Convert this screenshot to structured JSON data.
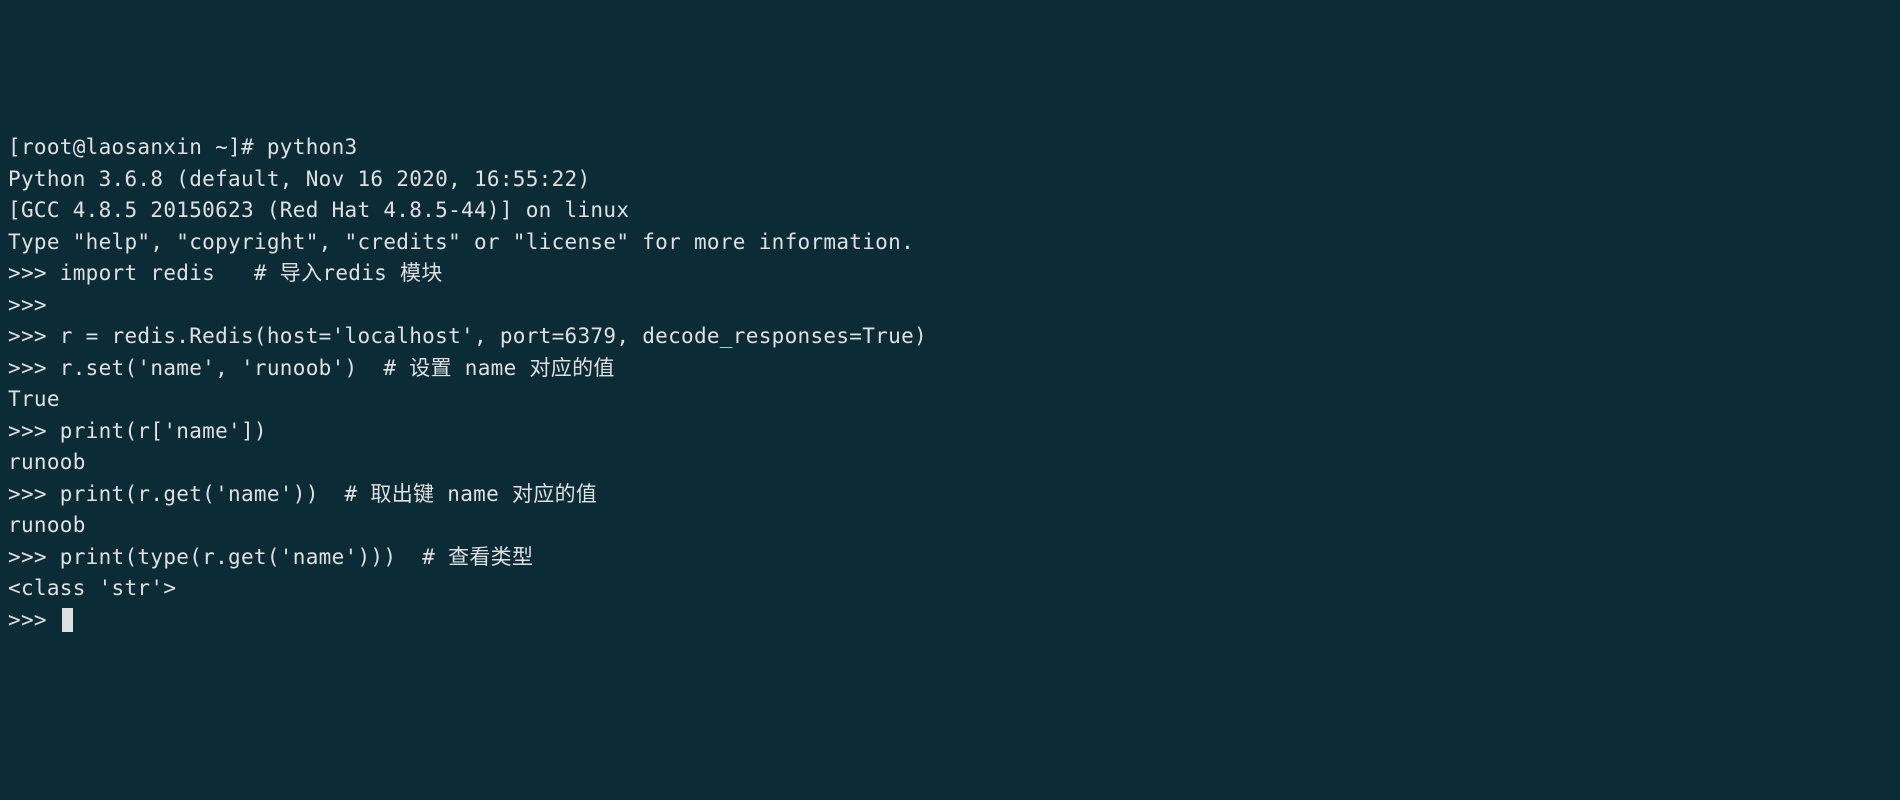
{
  "terminal": {
    "lines": [
      "[root@laosanxin ~]# python3",
      "Python 3.6.8 (default, Nov 16 2020, 16:55:22)",
      "[GCC 4.8.5 20150623 (Red Hat 4.8.5-44)] on linux",
      "Type \"help\", \"copyright\", \"credits\" or \"license\" for more information.",
      ">>> import redis   # 导入redis 模块",
      ">>>",
      ">>> r = redis.Redis(host='localhost', port=6379, decode_responses=True)",
      ">>> r.set('name', 'runoob')  # 设置 name 对应的值",
      "True",
      ">>> print(r['name'])",
      "runoob",
      ">>> print(r.get('name'))  # 取出键 name 对应的值",
      "runoob",
      ">>> print(type(r.get('name')))  # 查看类型",
      "<class 'str'>",
      ">>> "
    ]
  }
}
